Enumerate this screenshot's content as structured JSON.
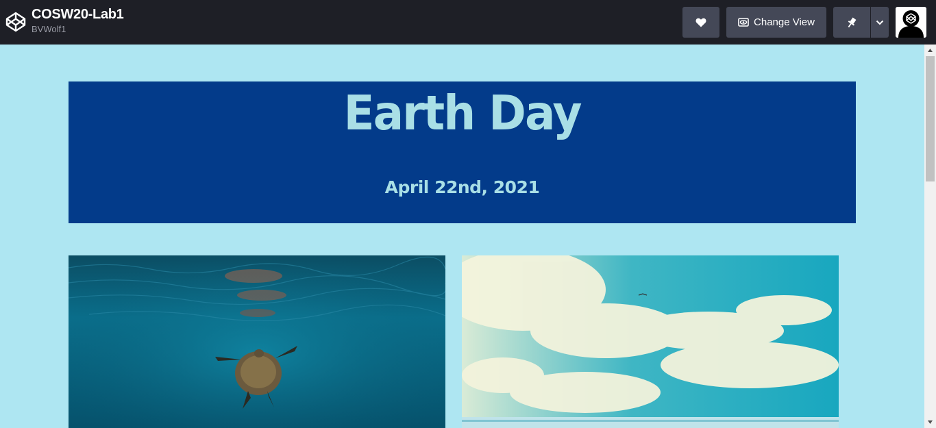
{
  "header": {
    "pen_title": "COSW20-Lab1",
    "author": "BVWolf1",
    "logo_icon": "codepen-logo-icon",
    "like_icon": "heart-icon",
    "change_view_label": "Change View",
    "change_view_icon": "eye-icon",
    "pin_icon": "pin-icon",
    "more_icon": "chevron-down-icon",
    "avatar_icon": "avatar-icon"
  },
  "page": {
    "title": "Earth Day",
    "date": "April 22nd, 2021"
  },
  "colors": {
    "topbar": "#1e1f26",
    "button": "#444857",
    "page_background": "#aee6f2",
    "banner": "#033b8a",
    "banner_text": "#a9dfe6"
  },
  "images": [
    {
      "subject": "sea turtle swimming underwater"
    },
    {
      "subject": "cloudy sky over beach"
    }
  ]
}
